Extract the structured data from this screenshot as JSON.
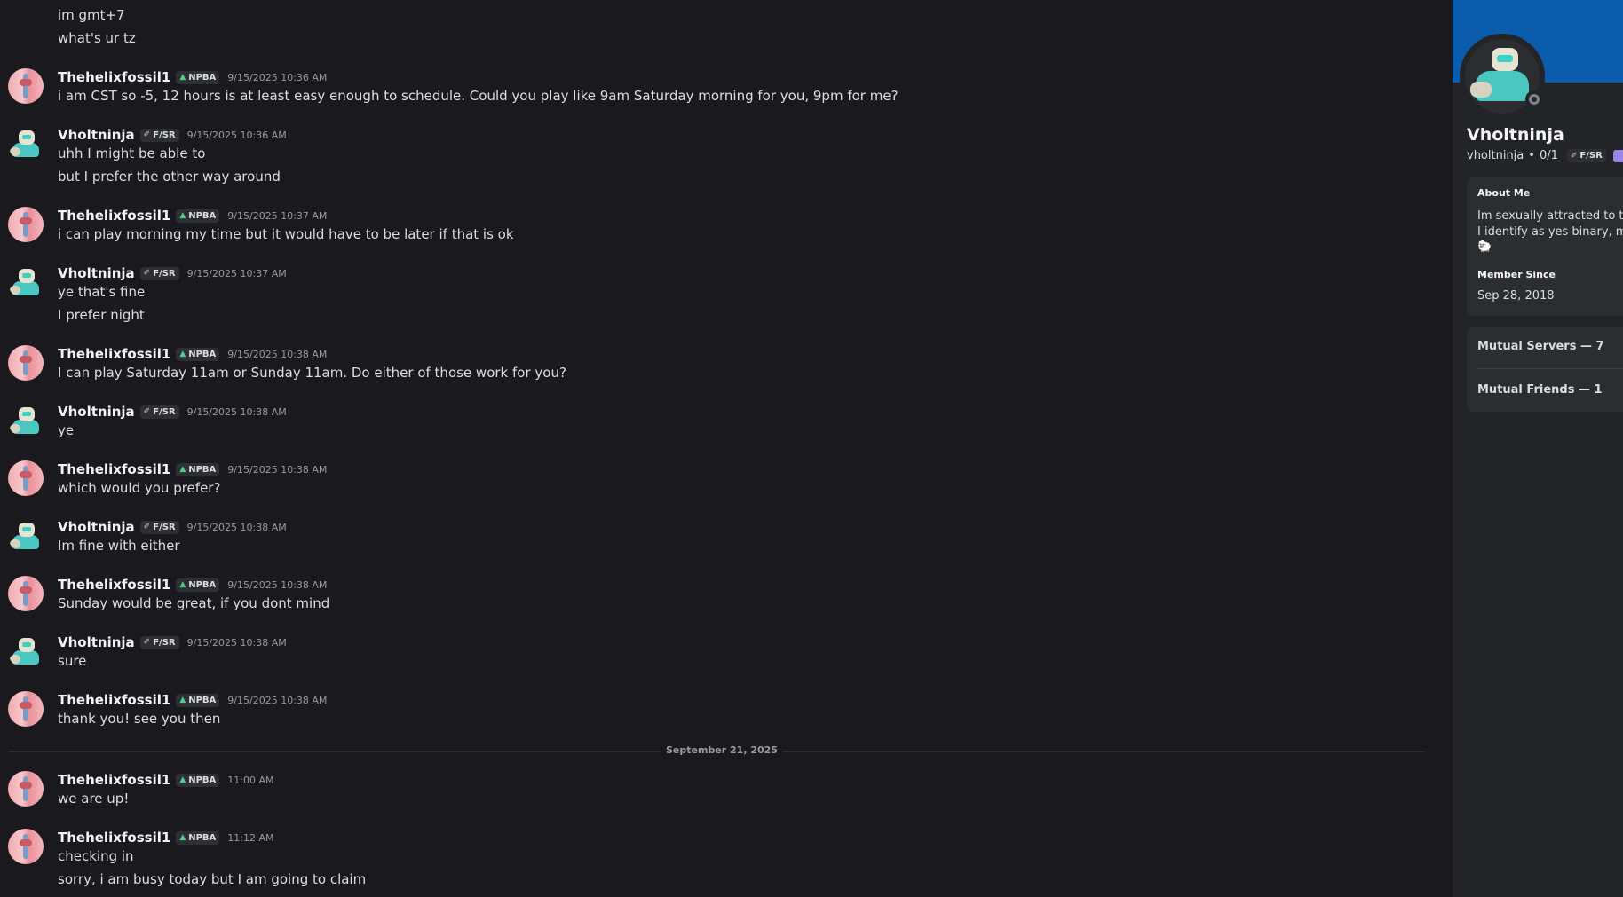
{
  "chat": {
    "prev_lines": [
      "im gmt+7",
      "what's ur tz"
    ],
    "messages": [
      {
        "author": "Thehelixfossil1",
        "tag": "NPBA",
        "time": "9/15/2025 10:36 AM",
        "lines": [
          "i am CST so -5, 12 hours is at least easy enough to schedule. Could you play like 9am Saturday morning for you, 9pm for me?"
        ]
      },
      {
        "author": "Vholtninja",
        "tag": "F/SR",
        "time": "9/15/2025 10:36 AM",
        "lines": [
          "uhh I might be able to",
          "but I prefer the other way around"
        ]
      },
      {
        "author": "Thehelixfossil1",
        "tag": "NPBA",
        "time": "9/15/2025 10:37 AM",
        "lines": [
          "i can play morning my time but it would have to be later if that is ok"
        ]
      },
      {
        "author": "Vholtninja",
        "tag": "F/SR",
        "time": "9/15/2025 10:37 AM",
        "lines": [
          "ye that's fine",
          "I prefer night"
        ]
      },
      {
        "author": "Thehelixfossil1",
        "tag": "NPBA",
        "time": "9/15/2025 10:38 AM",
        "lines": [
          "I can play Saturday 11am or Sunday 11am. Do either of those work for you?"
        ]
      },
      {
        "author": "Vholtninja",
        "tag": "F/SR",
        "time": "9/15/2025 10:38 AM",
        "lines": [
          "ye"
        ]
      },
      {
        "author": "Thehelixfossil1",
        "tag": "NPBA",
        "time": "9/15/2025 10:38 AM",
        "lines": [
          "which would you prefer?"
        ]
      },
      {
        "author": "Vholtninja",
        "tag": "F/SR",
        "time": "9/15/2025 10:38 AM",
        "lines": [
          "Im fine with either"
        ]
      },
      {
        "author": "Thehelixfossil1",
        "tag": "NPBA",
        "time": "9/15/2025 10:38 AM",
        "lines": [
          "Sunday would be great, if you dont mind"
        ]
      },
      {
        "author": "Vholtninja",
        "tag": "F/SR",
        "time": "9/15/2025 10:38 AM",
        "lines": [
          "sure"
        ]
      },
      {
        "author": "Thehelixfossil1",
        "tag": "NPBA",
        "time": "9/15/2025 10:38 AM",
        "lines": [
          "thank you! see you then"
        ]
      },
      {
        "author": "Thehelixfossil1",
        "tag": "NPBA",
        "time": "11:00 AM",
        "lines": [
          "we are up!"
        ]
      },
      {
        "author": "Thehelixfossil1",
        "tag": "NPBA",
        "time": "11:12 AM",
        "lines": [
          "checking in",
          "sorry, i am busy today but I am going to claim"
        ]
      }
    ],
    "date_divider": "September 21, 2025"
  },
  "profile": {
    "display_name": "Vholtninja",
    "username": "vholtninja",
    "pronouns": "0/1",
    "tag": "F/SR",
    "about_heading": "About Me",
    "about_lines": [
      "Im sexually attracted to the",
      "I identify as yes binary, my p"
    ],
    "about_emoji": "🐑",
    "member_since_heading": "Member Since",
    "member_since": "Sep 28, 2018",
    "mutual_servers": "Mutual Servers — 7",
    "mutual_friends": "Mutual Friends — 1",
    "banner_color": "#0b5cad",
    "status": "offline"
  }
}
